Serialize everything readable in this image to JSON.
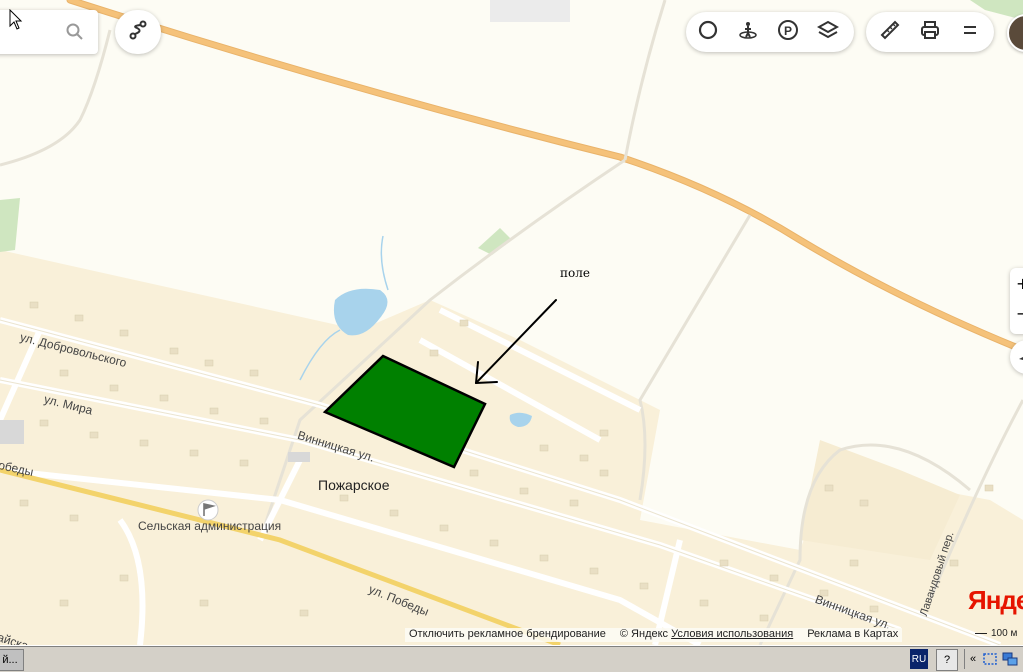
{
  "map": {
    "annotation_text": "поле",
    "place_name": "Пожарское",
    "poi_label": "Сельская администрация",
    "streets": {
      "dobrovolskogo": "ул. Добровольского",
      "mira": "ул. Мира",
      "vinnitskaya_1": "Винницкая ул.",
      "vinnitskaya_2": "Винницкая ул.",
      "pobedy_1": "ул. Победы",
      "pobedy_2": "обеды",
      "lavandovy": "Лавандовый пер.",
      "edge_bottom_left": "айская"
    },
    "logo_text": "Яндекс",
    "colors": {
      "field": "#008000",
      "highway": "#f5c27a",
      "residential": "#f9f0d9",
      "water": "#a8d3ec"
    }
  },
  "controls": {
    "search_icon": "search-icon",
    "route_icon": "route-icon",
    "layers": [
      "traffic-icon",
      "panorama-icon",
      "parking-icon",
      "layers-icon"
    ],
    "tools": [
      "ruler-icon",
      "print-icon",
      "menu-icon"
    ],
    "zoom_in_label": "+",
    "zoom_out_label": "−"
  },
  "footer": {
    "disable_ads": "Отключить рекламное брендирование",
    "copyright": "© Яндекс",
    "terms": "Условия использования",
    "advertise": "Реклама в Картах",
    "scale": "100 м"
  },
  "taskbar": {
    "app_label": "й...",
    "lang": "RU",
    "help": "?",
    "chevron": "«"
  }
}
